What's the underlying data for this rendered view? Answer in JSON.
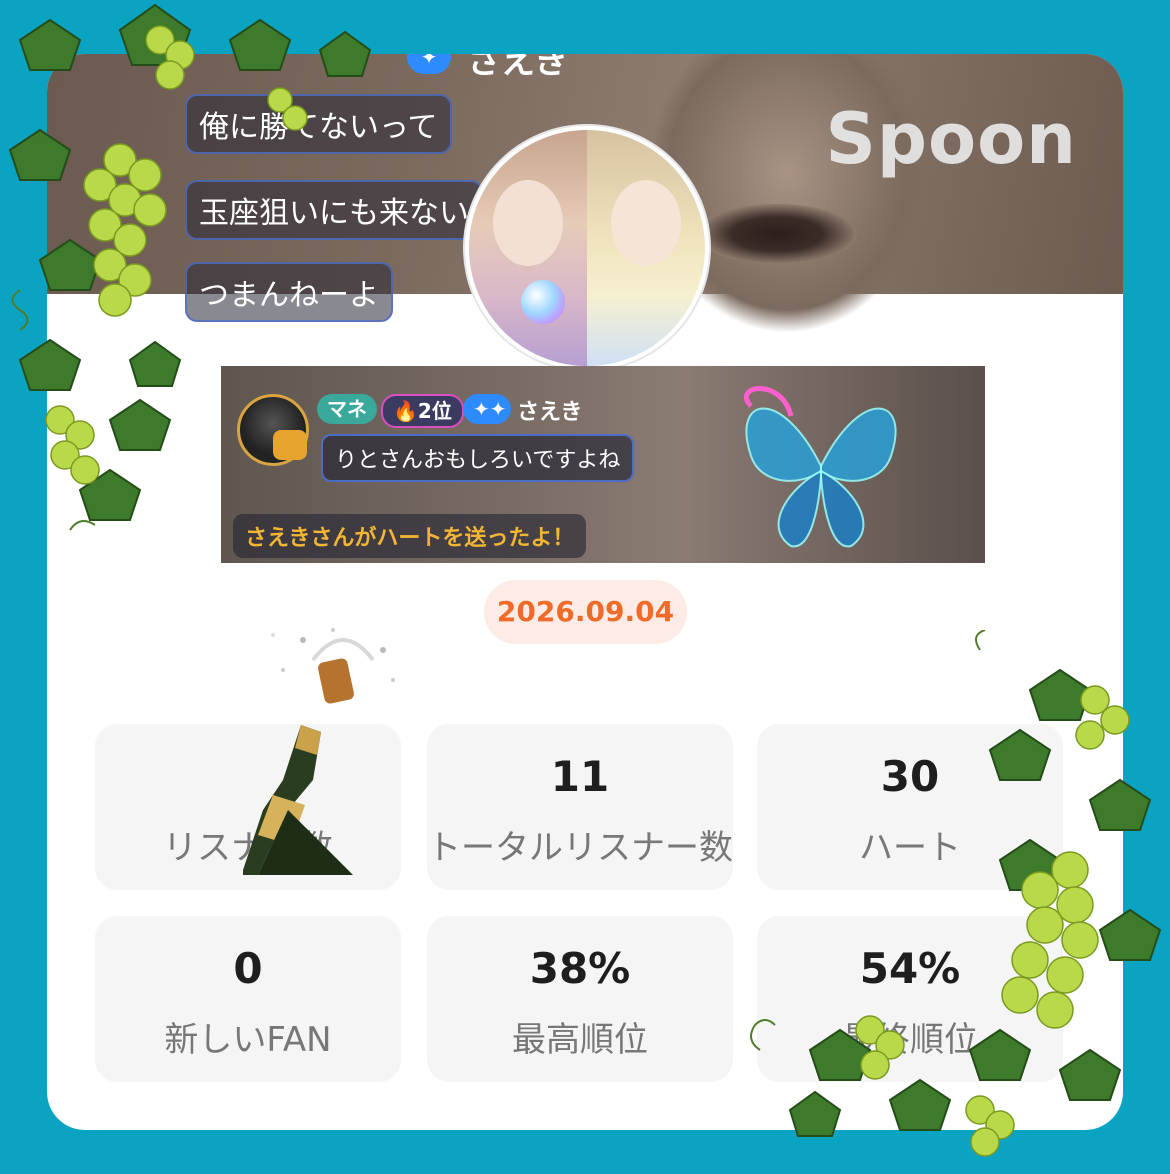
{
  "banner": {
    "brand": "Spoon",
    "chat_name": "さえき",
    "chat_lines": [
      "俺に勝てないって",
      "玉座狙いにも来ない",
      "つまんねーよ"
    ]
  },
  "comment_shot": {
    "tag_mane": "マネ",
    "tag_rank": "🔥2位",
    "tag_spark": "✦✦",
    "name": "さえき",
    "message": "りとさんおもしろいですよね",
    "event": "さえきさんがハートを送ったよ！"
  },
  "date": "2026.09.04",
  "stats": [
    {
      "value": "",
      "label": "リスナー数"
    },
    {
      "value": "11",
      "label": "トータルリスナー数"
    },
    {
      "value": "30",
      "label": "ハート"
    },
    {
      "value": "0",
      "label": "新しいFAN"
    },
    {
      "value": "38%",
      "label": "最高順位"
    },
    {
      "value": "54%",
      "label": "最終順位"
    }
  ],
  "colors": {
    "background": "#0aa3c2",
    "date_text": "#f06a2a",
    "date_bg": "#fdece6",
    "stat_bg": "#f5f5f5"
  },
  "icons": [
    "champagne-bottle-icon",
    "grape-vine-decoration",
    "butterfly-icon",
    "user-avatar"
  ]
}
